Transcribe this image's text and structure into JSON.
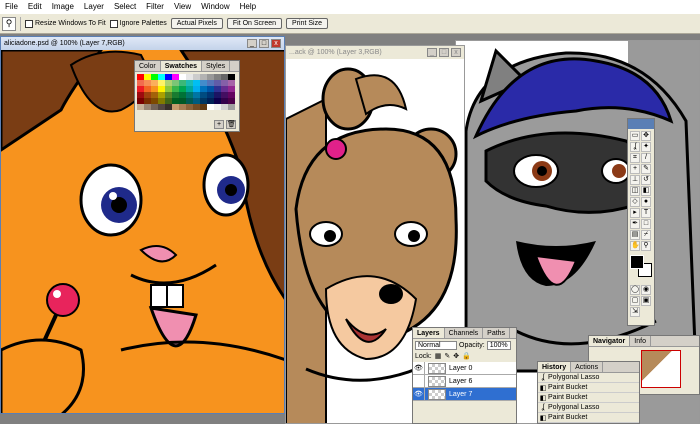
{
  "menu": [
    "File",
    "Edit",
    "Image",
    "Layer",
    "Select",
    "Filter",
    "View",
    "Window",
    "Help"
  ],
  "options": {
    "resize_label": "Resize Windows To Fit",
    "ignore_label": "Ignore Palettes",
    "actual_pixels": "Actual Pixels",
    "fit_on_screen": "Fit On Screen",
    "print_size": "Print Size"
  },
  "doc_main": {
    "title": "aliciadone.psd @ 100% (Layer 7,RGB)"
  },
  "doc_bear": {
    "title": "...ack @ 100% (Layer 3,RGB)"
  },
  "swatches": {
    "tabs": [
      "Color",
      "Swatches",
      "Styles"
    ],
    "active_tab": "Swatches",
    "colors": [
      "#ff0000",
      "#ffff00",
      "#00ff00",
      "#00ffff",
      "#0000ff",
      "#ff00ff",
      "#ffffff",
      "#e6e6e6",
      "#cccccc",
      "#b3b3b3",
      "#999999",
      "#808080",
      "#666666",
      "#000000",
      "#f26c4f",
      "#f68e55",
      "#fbaf5c",
      "#fff467",
      "#acd372",
      "#7cc576",
      "#3bb878",
      "#1abbb4",
      "#00bff3",
      "#438ccb",
      "#5574b9",
      "#605ca8",
      "#855fa8",
      "#a763a8",
      "#ed1c24",
      "#f26522",
      "#f7941d",
      "#fff200",
      "#8dc63f",
      "#39b54a",
      "#00a651",
      "#00a99d",
      "#00aeef",
      "#0072bc",
      "#0054a6",
      "#2e3192",
      "#662d91",
      "#92278f",
      "#9e0b0f",
      "#a0410d",
      "#a36209",
      "#aba000",
      "#598527",
      "#197b30",
      "#007236",
      "#00746b",
      "#0076a3",
      "#004b80",
      "#003471",
      "#1b1464",
      "#440e62",
      "#630460",
      "#790000",
      "#7b2e00",
      "#7d4900",
      "#827b00",
      "#406618",
      "#005e20",
      "#005826",
      "#005952",
      "#005b7f",
      "#003663",
      "#002157",
      "#0d004c",
      "#32004b",
      "#4b0049",
      "#c7b299",
      "#998675",
      "#736357",
      "#534741",
      "#37302a",
      "#c69c6d",
      "#a67c52",
      "#8c6239",
      "#754c24",
      "#603913",
      "#ffffff",
      "#f0f0f0",
      "#d2d2d2",
      "#a0a0a0"
    ]
  },
  "layers": {
    "tabs": [
      "Layers",
      "Channels",
      "Paths"
    ],
    "blend_mode": "Normal",
    "opacity_label": "Opacity:",
    "opacity_value": "100%",
    "lock_label": "Lock:",
    "rows": [
      {
        "name": "Layer 0",
        "selected": false
      },
      {
        "name": "Layer 6",
        "selected": false
      },
      {
        "name": "Layer 7",
        "selected": true
      }
    ]
  },
  "navigator": {
    "tabs": [
      "Navigator",
      "Info"
    ]
  },
  "history": {
    "tabs": [
      "History",
      "Actions"
    ],
    "items": [
      "Polygonal Lasso",
      "Paint Bucket",
      "Paint Bucket",
      "Polygonal Lasso",
      "Paint Bucket"
    ]
  },
  "colors": {
    "selection": "#2f6fd1",
    "squirrel_orange": "#f7931e",
    "bear_brown": "#b68a5a",
    "raccoon_blue": "#2a2aa8"
  }
}
